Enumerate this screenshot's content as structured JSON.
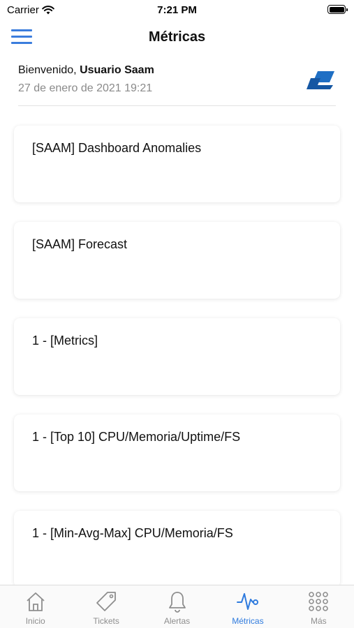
{
  "status_bar": {
    "carrier": "Carrier",
    "time": "7:21 PM",
    "wifi_icon": "wifi-icon",
    "battery_icon": "battery-icon"
  },
  "nav": {
    "title": "Métricas",
    "menu_icon": "hamburger-menu-icon",
    "accent_color": "#3b7ddd"
  },
  "welcome": {
    "greeting": "Bienvenido,",
    "user_name": "Usuario Saam",
    "date": "27 de enero de 2021 19:21",
    "logo_icon": "brand-logo-icon"
  },
  "cards": [
    {
      "title": "[SAAM] Dashboard Anomalies"
    },
    {
      "title": "[SAAM] Forecast"
    },
    {
      "title": "1 - [Metrics]"
    },
    {
      "title": "1 - [Top 10] CPU/Memoria/Uptime/FS"
    },
    {
      "title": "1 - [Min-Avg-Max] CPU/Memoria/FS"
    }
  ],
  "tabbar": {
    "active_color": "#2f7bde",
    "inactive_color": "#8e8e8e",
    "tabs": [
      {
        "label": "Inicio",
        "icon": "home-icon",
        "active": false
      },
      {
        "label": "Tickets",
        "icon": "tag-icon",
        "active": false
      },
      {
        "label": "Alertas",
        "icon": "bell-icon",
        "active": false
      },
      {
        "label": "Métricas",
        "icon": "pulse-icon",
        "active": true
      },
      {
        "label": "Más",
        "icon": "grid-dots-icon",
        "active": false
      }
    ]
  }
}
